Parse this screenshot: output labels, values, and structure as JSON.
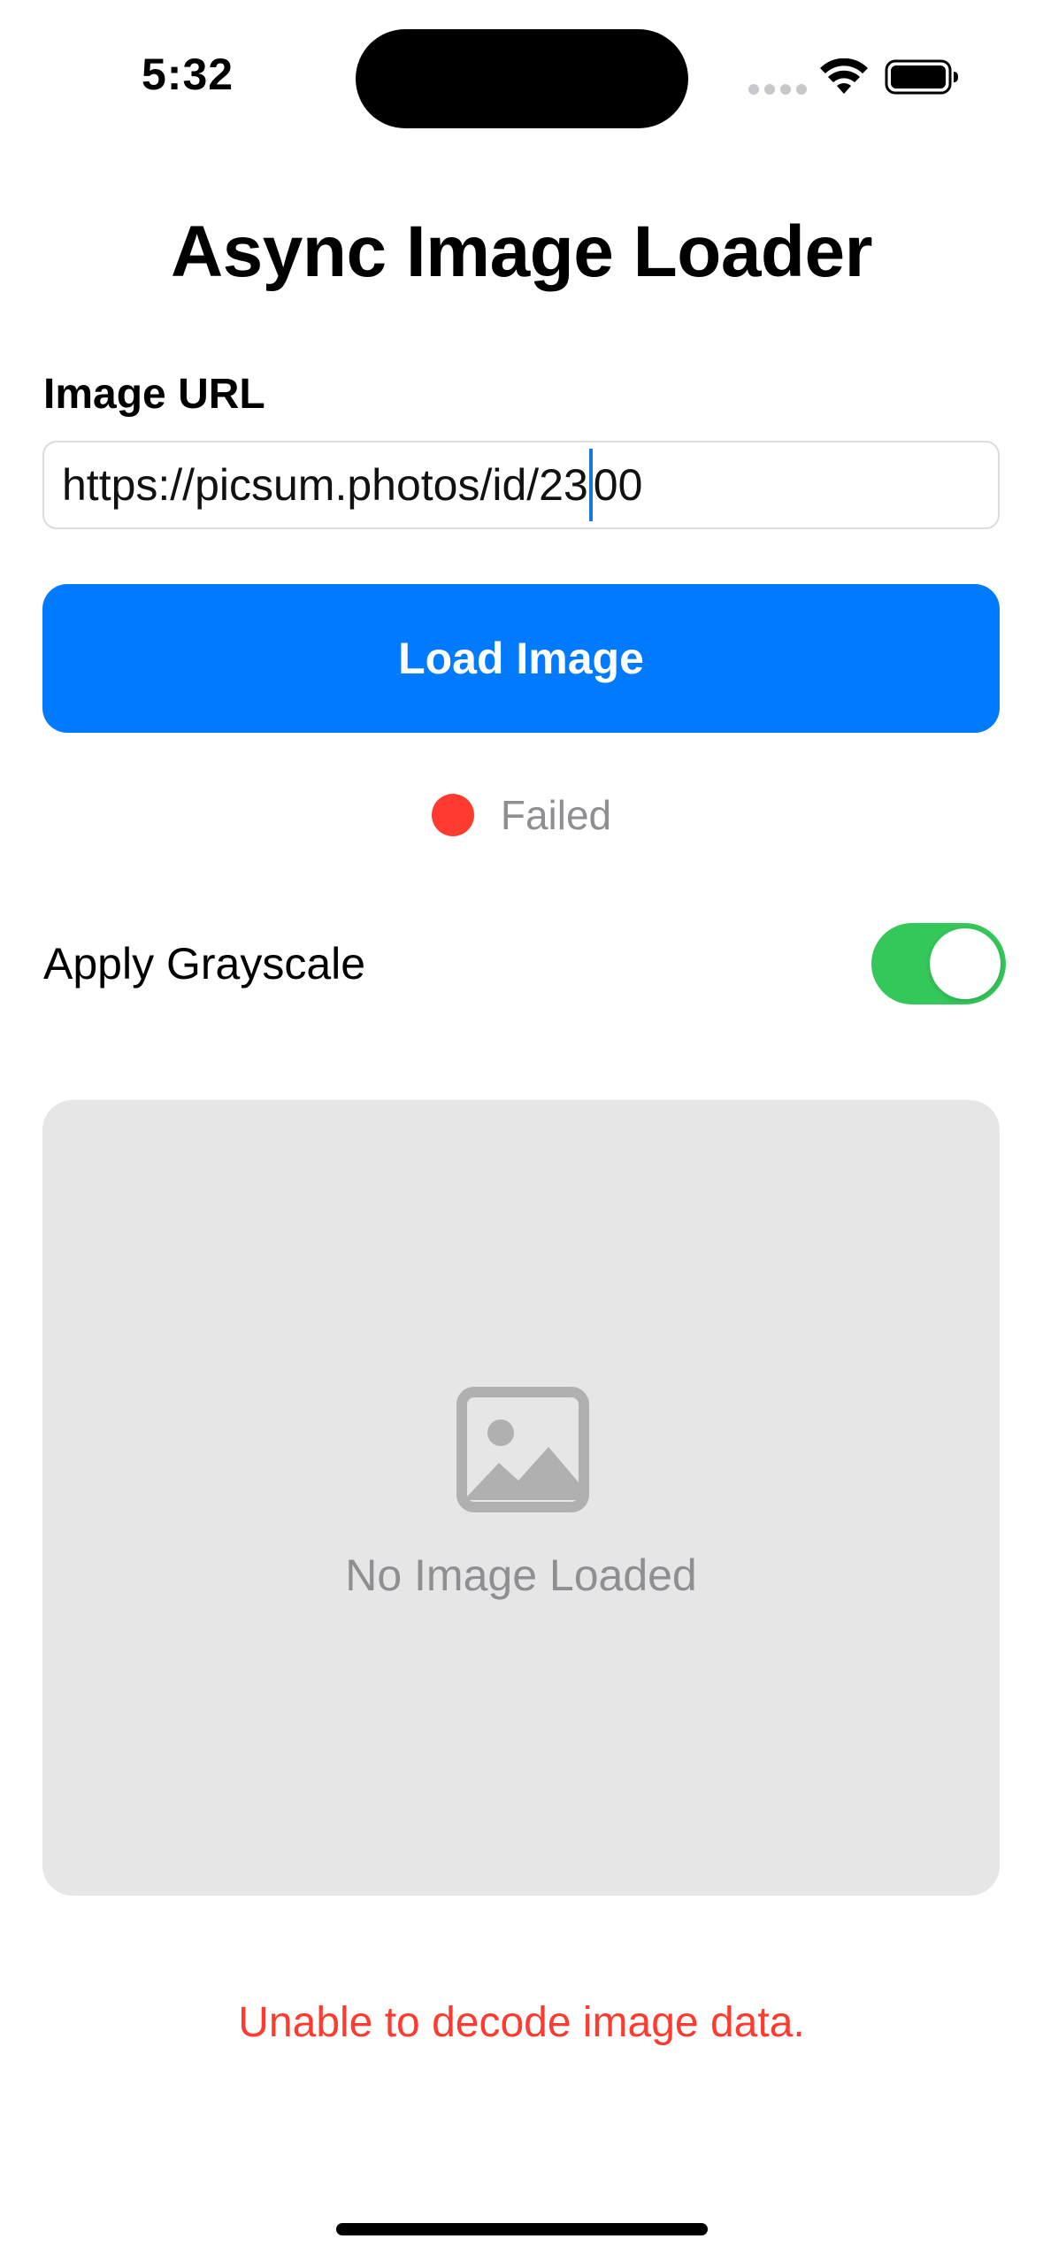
{
  "status_bar": {
    "time": "5:32",
    "wifi_icon": "wifi-icon",
    "battery_icon": "battery-full-icon"
  },
  "page": {
    "title": "Async Image Loader"
  },
  "url_field": {
    "label": "Image URL",
    "value_before_caret": "https://picsum.photos/id/23",
    "value_after_caret": "00"
  },
  "load_button": {
    "label": "Load Image",
    "color": "#007aff"
  },
  "status": {
    "text": "Failed",
    "color": "#ff3b30"
  },
  "grayscale": {
    "label": "Apply Grayscale",
    "enabled": true,
    "color": "#34c759"
  },
  "preview": {
    "icon": "photo-icon",
    "placeholder": "No Image Loaded"
  },
  "error": {
    "message": "Unable to decode image data.",
    "color": "#ff3b30"
  }
}
